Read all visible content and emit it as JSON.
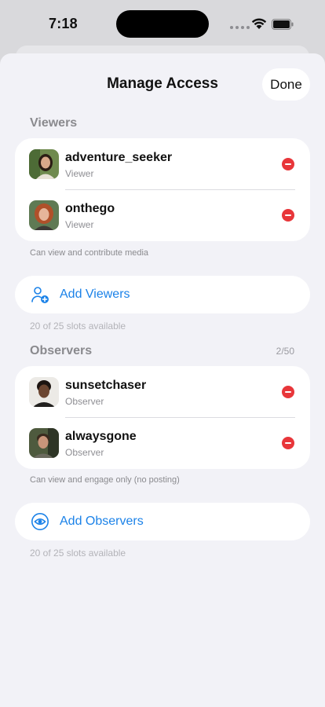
{
  "status": {
    "time": "7:18"
  },
  "sheet": {
    "title": "Manage Access",
    "done_label": "Done"
  },
  "viewers": {
    "header": "Viewers",
    "items": [
      {
        "name": "adventure_seeker",
        "role": "Viewer"
      },
      {
        "name": "onthego",
        "role": "Viewer"
      }
    ],
    "description": "Can view and contribute media",
    "add_label": "Add Viewers",
    "slots": "20 of 25 slots available"
  },
  "observers": {
    "header": "Observers",
    "count": "2/50",
    "items": [
      {
        "name": "sunsetchaser",
        "role": "Observer"
      },
      {
        "name": "alwaysgone",
        "role": "Observer"
      }
    ],
    "description": "Can view and engage only (no posting)",
    "add_label": "Add Observers",
    "slots": "20 of 25 slots available"
  },
  "colors": {
    "accent": "#1b82e8",
    "destructive": "#e8363a",
    "background": "#f2f2f7"
  }
}
